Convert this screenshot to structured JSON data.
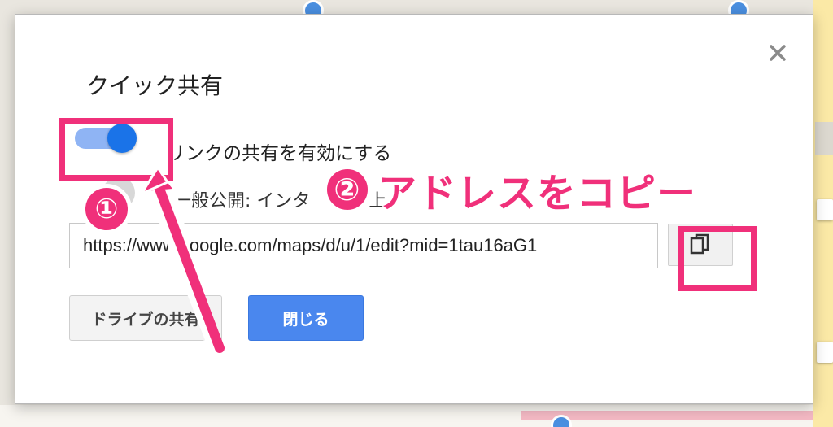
{
  "dialog": {
    "title": "クイック共有",
    "toggle_label": "リンクの共有を有効にする",
    "toggle_on": true,
    "public_text": "一般公開: インタ",
    "public_text_2": "ン",
    "public_text_3": "上",
    "url_value": "https://www.google.com/maps/d/u/1/edit?mid=1tau16aG1",
    "drive_share_label": "ドライブの共有",
    "close_label": "閉じる"
  },
  "annotations": {
    "step1": "①",
    "step2_num": "②",
    "step2_text": "アドレスをコピー"
  },
  "colors": {
    "accent": "#f0307a",
    "primary_button": "#4a87ee",
    "toggle_knob": "#1a73e8"
  }
}
